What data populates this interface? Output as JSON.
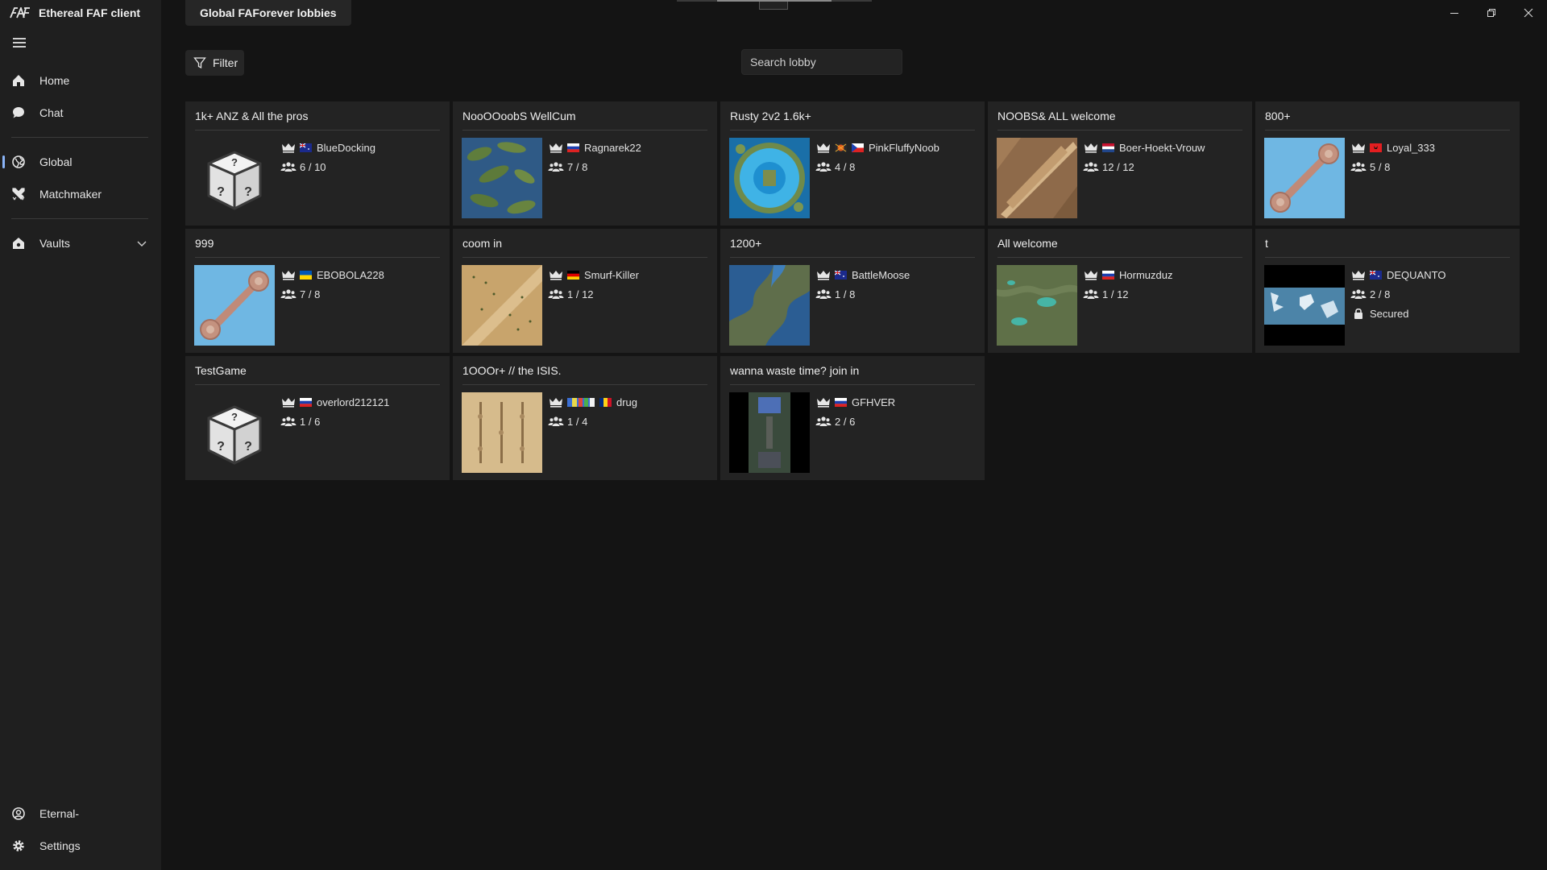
{
  "app": {
    "title": "Ethereal FAF client",
    "tab_title": "Global FAForever lobbies"
  },
  "sidebar": {
    "items": [
      {
        "label": "Home",
        "icon": "home-icon"
      },
      {
        "label": "Chat",
        "icon": "chat-icon"
      },
      {
        "label": "Global",
        "icon": "globe-icon"
      },
      {
        "label": "Matchmaker",
        "icon": "swords-icon"
      },
      {
        "label": "Vaults",
        "icon": "vault-icon"
      }
    ],
    "user": {
      "label": "Eternal-",
      "icon": "user-circle-icon"
    },
    "settings": {
      "label": "Settings",
      "icon": "gear-icon"
    }
  },
  "toolbar": {
    "filter_label": "Filter",
    "search_placeholder": "Search lobby"
  },
  "lobbies": [
    {
      "title": "1k+ ANZ & All the pros",
      "host": "BlueDocking",
      "players": "6 / 10",
      "flag": "au",
      "map": "unknown"
    },
    {
      "title": "NooOOoobS WellCum",
      "host": "Ragnarek22",
      "players": "7 / 8",
      "flag": "ru",
      "map": "islands"
    },
    {
      "title": "Rusty 2v2 1.6k+",
      "host": "PinkFluffyNoob",
      "players": "4 / 8",
      "flag": "cz",
      "map": "atoll"
    },
    {
      "title": "NOOBS& ALL welcome",
      "host": "Boer-Hoekt-Vrouw",
      "players": "12 / 12",
      "flag": "nl",
      "map": "desert-diag"
    },
    {
      "title": "800+",
      "host": "Loyal_333",
      "players": "5 / 8",
      "flag": "al",
      "map": "bone"
    },
    {
      "title": "999",
      "host": "EBOBOLA228",
      "players": "7 / 8",
      "flag": "ua",
      "map": "bone"
    },
    {
      "title": "coom in",
      "host": "Smurf-Killer",
      "players": "1 / 12",
      "flag": "de",
      "map": "sand-diag"
    },
    {
      "title": "1200+",
      "host": "BattleMoose",
      "players": "1 / 8",
      "flag": "au",
      "map": "coast"
    },
    {
      "title": "All welcome",
      "host": "Hormuzduz",
      "players": "1 / 12",
      "flag": "ru",
      "map": "green"
    },
    {
      "title": "t",
      "host": "DEQUANTO",
      "players": "2 / 8",
      "flag": "au",
      "map": "ice",
      "status": "Secured"
    },
    {
      "title": "TestGame",
      "host": "overlord212121",
      "players": "1 / 6",
      "flag": "ru",
      "map": "unknown"
    },
    {
      "title": "1OOOr+ // the ISIS.",
      "host": "drug",
      "players": "1 / 4",
      "flag": "ro",
      "map": "sand-lanes"
    },
    {
      "title": "wanna waste time? join in",
      "host": "GFHVER",
      "players": "2 / 6",
      "flag": "ru",
      "map": "corridor"
    }
  ]
}
